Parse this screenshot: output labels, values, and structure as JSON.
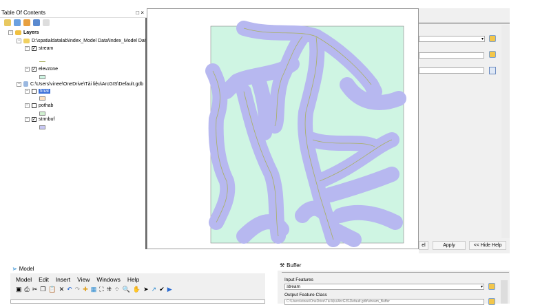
{
  "toc": {
    "title": "Table Of Contents",
    "controls": "□ ×",
    "root": "Layers",
    "groups": [
      {
        "path": "D:\\spatialdatalab\\Index_Model Data\\Index_Model Dat.",
        "layers": [
          {
            "name": "stream",
            "checked": true
          },
          {
            "name": "elevzone",
            "checked": true
          }
        ]
      },
      {
        "path": "C:\\Users\\vinee\\OneDrive\\Tài liệu\\ArcGIS\\Default.gdb",
        "layers": [
          {
            "name": "final",
            "checked": false
          },
          {
            "name": "pothab",
            "checked": false
          },
          {
            "name": "strmbuf",
            "checked": true
          }
        ]
      }
    ]
  },
  "tool_panel": {
    "cancel_partial": "el",
    "apply": "Apply",
    "hide_help": "<< Hide Help"
  },
  "model": {
    "title": "Model",
    "menu": [
      "Model",
      "Edit",
      "Insert",
      "View",
      "Windows",
      "Help"
    ]
  },
  "buffer": {
    "title": "Buffer",
    "input_label": "Input Features",
    "input_value": "stream",
    "output_label": "Output Feature Class",
    "output_value": "C:\\Users\\vinee\\OneDrive\\Tài liệu\\ArcGIS\\Default.gdb\\stream_Buffer"
  },
  "colors": {
    "buffer": "#b7b8f0",
    "extent": "#cff5e3",
    "stream": "#a9b060",
    "selected": "#3a6fd8"
  }
}
